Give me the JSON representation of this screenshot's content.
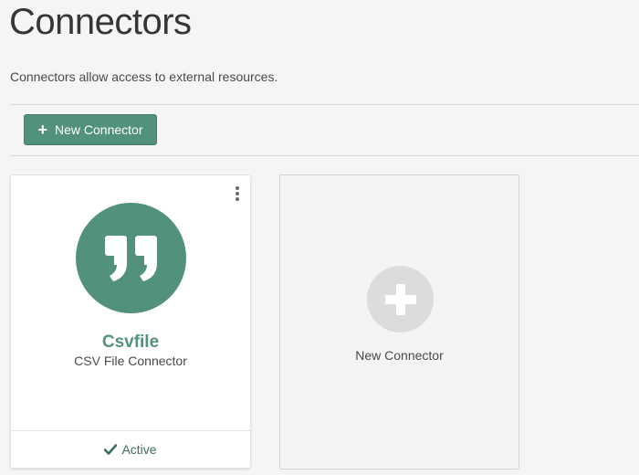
{
  "header": {
    "title": "Connectors",
    "description": "Connectors allow access to external resources."
  },
  "toolbar": {
    "new_connector_label": "New Connector",
    "new_connector_icon": "plus-icon"
  },
  "connectors": [
    {
      "name": "Csvfile",
      "subtitle": "CSV File Connector",
      "icon": "quote-icon",
      "status": "Active",
      "status_icon": "check-icon",
      "menu_icon": "kebab-menu-icon"
    }
  ],
  "new_card": {
    "label": "New Connector",
    "icon": "plus-icon"
  },
  "colors": {
    "accent": "#51917e",
    "status_text": "#3b6e5f",
    "placeholder_circle": "#dcdcdc",
    "background": "#f5f5f5"
  }
}
